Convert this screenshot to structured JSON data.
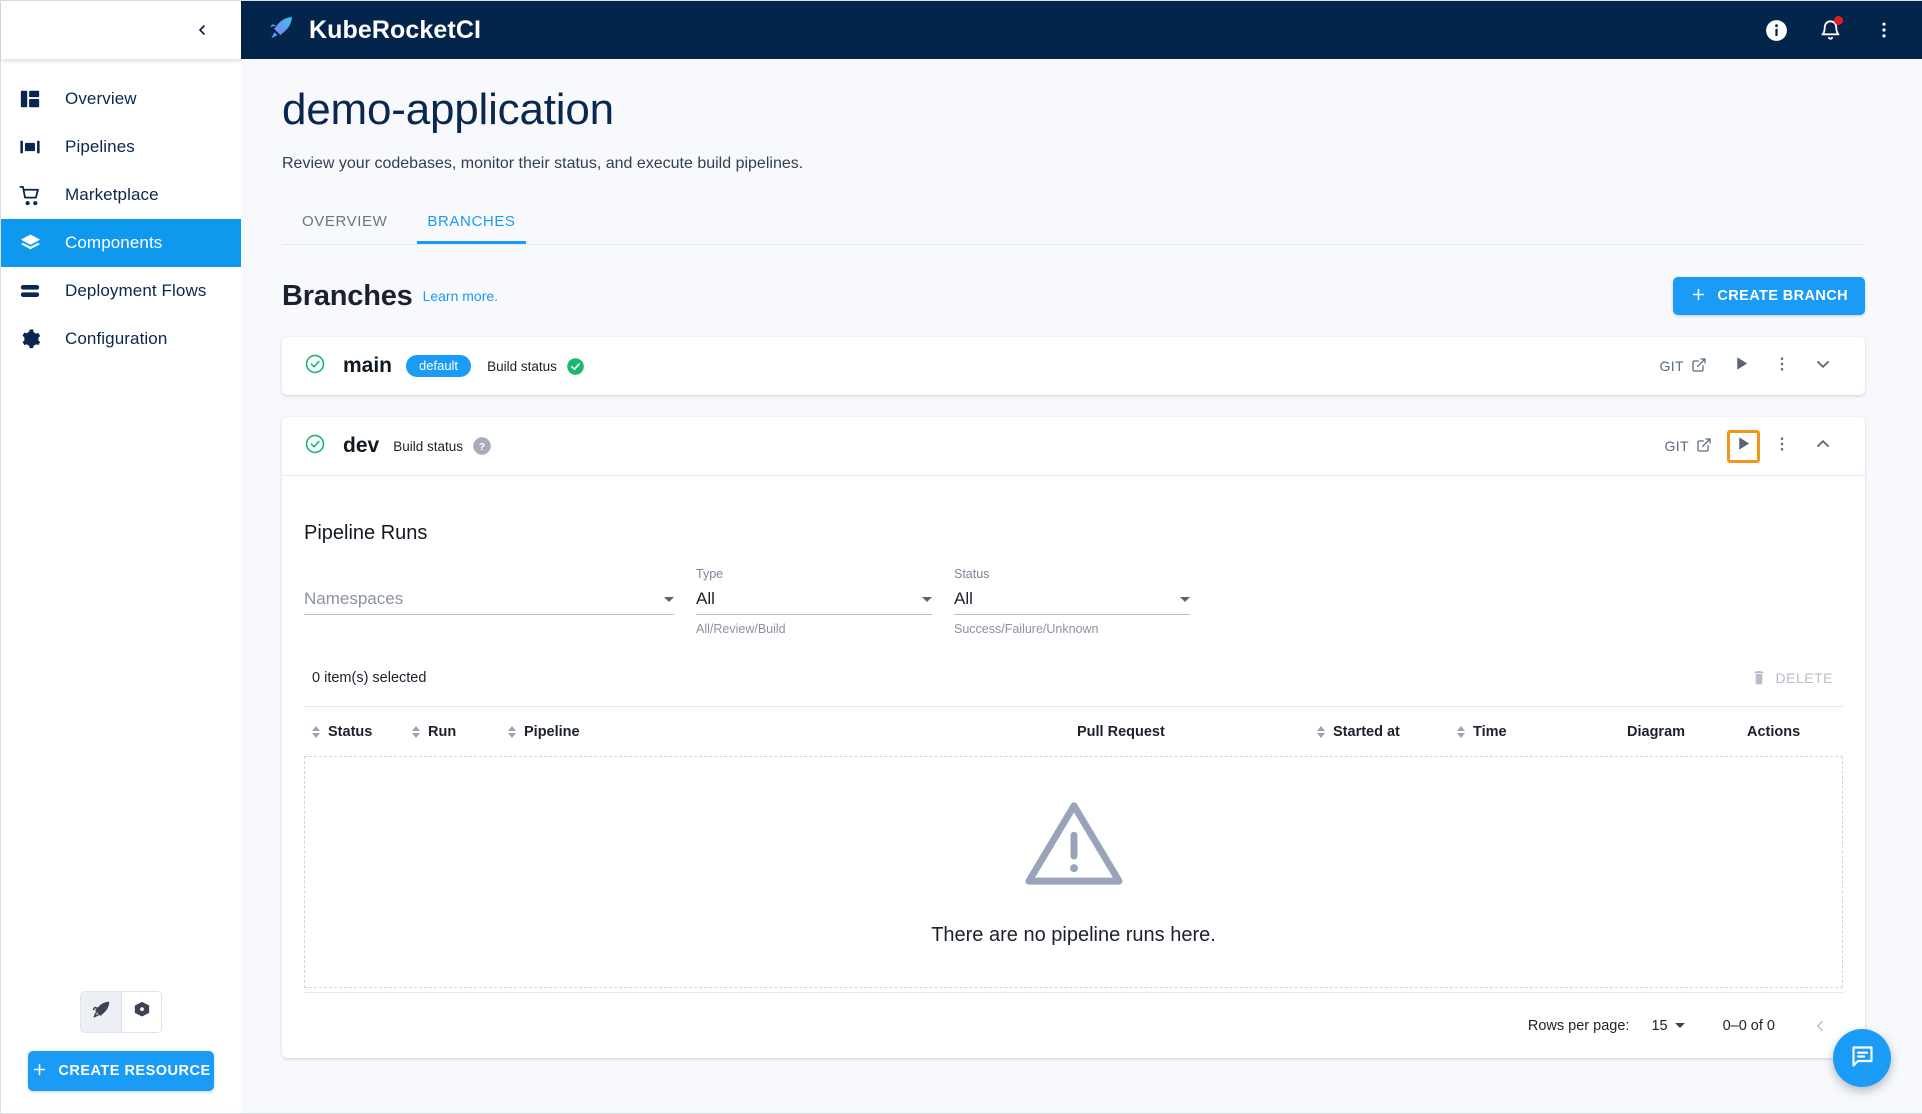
{
  "sidebar": {
    "collapse_icon": "chevron-left-icon",
    "items": [
      {
        "label": "Overview",
        "icon": "dashboard-icon",
        "active": false
      },
      {
        "label": "Pipelines",
        "icon": "pipelines-icon",
        "active": false
      },
      {
        "label": "Marketplace",
        "icon": "cart-icon",
        "active": false
      },
      {
        "label": "Components",
        "icon": "layers-icon",
        "active": true
      },
      {
        "label": "Deployment Flows",
        "icon": "flows-icon",
        "active": false
      },
      {
        "label": "Configuration",
        "icon": "gear-icon",
        "active": false
      }
    ],
    "mode_toggle": [
      {
        "icon": "rocket-icon",
        "selected": true
      },
      {
        "icon": "kubernetes-icon",
        "selected": false
      }
    ],
    "create_resource_label": "CREATE RESOURCE"
  },
  "topbar": {
    "brand": "KubeRocketCI",
    "brand_icon": "rocket-icon",
    "actions": [
      {
        "icon": "info-icon"
      },
      {
        "icon": "bell-icon",
        "has_badge": true
      },
      {
        "icon": "kebab-menu-icon"
      }
    ],
    "background": "#04254b"
  },
  "page": {
    "title": "demo-application",
    "subtitle": "Review your codebases, monitor their status, and execute build pipelines."
  },
  "tabs": [
    {
      "label": "OVERVIEW",
      "active": false
    },
    {
      "label": "BRANCHES",
      "active": true
    }
  ],
  "branches_section": {
    "title": "Branches",
    "learn_more": "Learn more.",
    "create_button": "CREATE BRANCH",
    "create_button_icon": "plus-icon"
  },
  "branches": [
    {
      "status_icon": "check-circle-icon",
      "name": "main",
      "chip": "default",
      "build_status_label": "Build status",
      "build_status_icon": "success-check-icon",
      "git_label": "GIT",
      "git_icon": "external-link-icon",
      "run_icon": "play-icon",
      "menu_icon": "kebab-menu-icon",
      "expand_icon": "chevron-down-icon",
      "expanded": false,
      "run_highlighted": false
    },
    {
      "status_icon": "check-circle-icon",
      "name": "dev",
      "chip": null,
      "build_status_label": "Build status",
      "build_status_icon": "unknown-question-icon",
      "git_label": "GIT",
      "git_icon": "external-link-icon",
      "run_icon": "play-icon",
      "menu_icon": "kebab-menu-icon",
      "expand_icon": "chevron-up-icon",
      "expanded": true,
      "run_highlighted": true
    }
  ],
  "pipeline_runs": {
    "title": "Pipeline Runs",
    "filters": [
      {
        "label": "",
        "value": "Namespaces",
        "is_placeholder": true,
        "help": ""
      },
      {
        "label": "Type",
        "value": "All",
        "is_placeholder": false,
        "help": "All/Review/Build"
      },
      {
        "label": "Status",
        "value": "All",
        "is_placeholder": false,
        "help": "Success/Failure/Unknown"
      }
    ],
    "selected_text": "0 item(s) selected",
    "delete_label": "DELETE",
    "delete_icon": "trash-icon",
    "columns": [
      {
        "label": "Status",
        "sortable": true
      },
      {
        "label": "Run",
        "sortable": true
      },
      {
        "label": "Pipeline",
        "sortable": true
      },
      {
        "label": "Pull Request",
        "sortable": false
      },
      {
        "label": "Started at",
        "sortable": true
      },
      {
        "label": "Time",
        "sortable": true
      },
      {
        "label": "Diagram",
        "sortable": false
      },
      {
        "label": "Actions",
        "sortable": false
      }
    ],
    "rows": [],
    "empty_state": {
      "icon": "warning-triangle-icon",
      "text": "There are no pipeline runs here."
    },
    "pagination": {
      "rows_per_page_label": "Rows per page:",
      "rows_per_page_value": "15",
      "range": "0–0 of 0",
      "prev_icon": "chevron-left-icon"
    }
  },
  "fab": {
    "icon": "chat-icon",
    "color": "#1a9bf5"
  },
  "colors": {
    "accent": "#1a9bf5",
    "header_bg": "#04254b",
    "page_bg": "#f7f9fc",
    "success": "#27ae60",
    "highlight": "#f5941d"
  }
}
